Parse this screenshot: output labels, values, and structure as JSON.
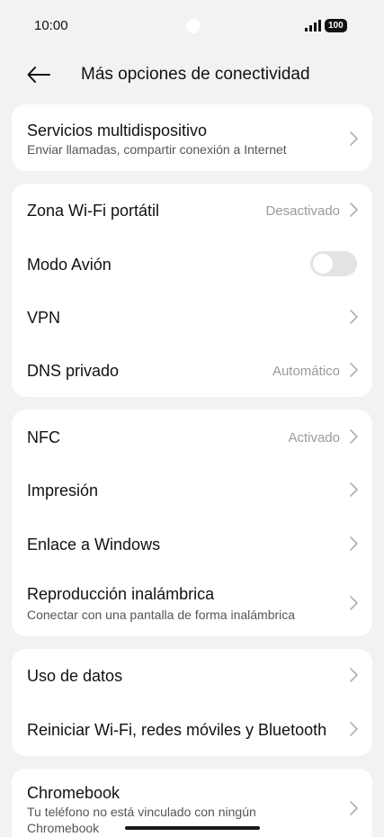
{
  "status": {
    "time": "10:00",
    "battery": "100"
  },
  "header": {
    "title": "Más opciones de conectividad"
  },
  "sections": {
    "multidevice": {
      "title": "Servicios multidispositivo",
      "subtitle": "Enviar llamadas, compartir conexión a Internet"
    },
    "hotspot": {
      "title": "Zona Wi-Fi portátil",
      "value": "Desactivado"
    },
    "airplane": {
      "title": "Modo Avión",
      "enabled": false
    },
    "vpn": {
      "title": "VPN"
    },
    "dns": {
      "title": "DNS privado",
      "value": "Automático"
    },
    "nfc": {
      "title": "NFC",
      "value": "Activado"
    },
    "printing": {
      "title": "Impresión"
    },
    "windows": {
      "title": "Enlace a Windows"
    },
    "wireless_display": {
      "title": "Reproducción inalámbrica",
      "subtitle": "Conectar con una pantalla de forma inalámbrica"
    },
    "data_usage": {
      "title": "Uso de datos"
    },
    "reset": {
      "title": "Reiniciar Wi-Fi, redes móviles y Bluetooth"
    },
    "chromebook": {
      "title": "Chromebook",
      "subtitle_line1": "Tu teléfono no está vinculado con ningún",
      "subtitle_line2": "Chromebook"
    }
  },
  "icons": {
    "back": "arrow-left-icon",
    "chevron": "chevron-right-icon",
    "signal": "signal-icon",
    "battery": "battery-icon"
  },
  "colors": {
    "background": "#f2f2f2",
    "card": "#ffffff",
    "secondary_text": "#9a9a9a",
    "toggle_off": "#e3e3e3"
  }
}
